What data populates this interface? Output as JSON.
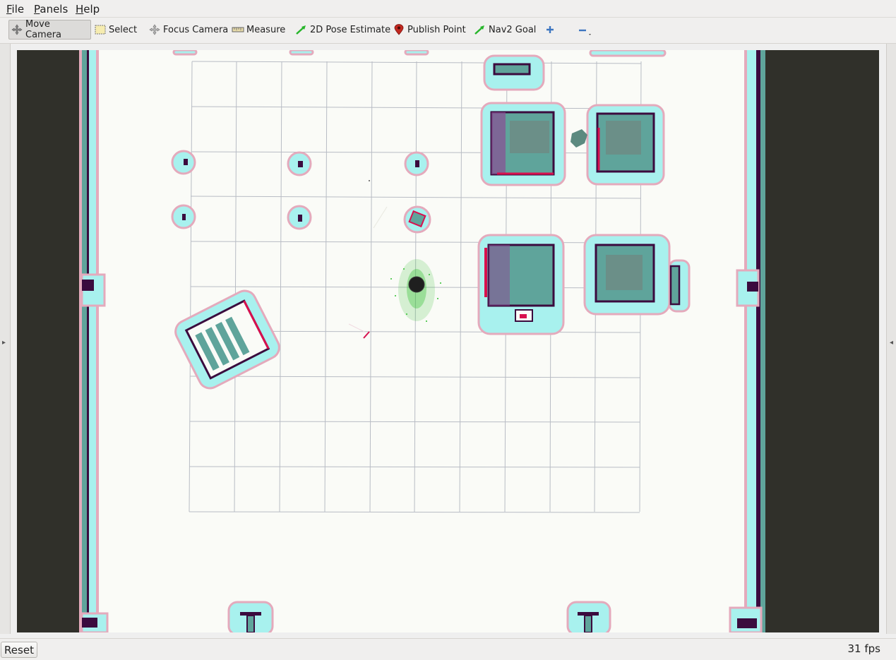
{
  "menu": {
    "items": [
      {
        "mnemonic": "F",
        "rest": "ile"
      },
      {
        "mnemonic": "P",
        "rest": "anels"
      },
      {
        "mnemonic": "H",
        "rest": "elp"
      }
    ]
  },
  "toolbar": {
    "move_camera": "Move Camera",
    "select": "Select",
    "focus_camera": "Focus Camera",
    "measure": "Measure",
    "pose_estimate": "2D Pose Estimate",
    "publish_point": "Publish Point",
    "nav2_goal": "Nav2 Goal",
    "active_tool": "Move Camera"
  },
  "icons": {
    "move": "move-camera-icon",
    "select": "select-icon",
    "focus": "focus-camera-icon",
    "measure": "measure-icon",
    "pose": "pose-arrow-icon",
    "point": "map-pin-icon",
    "goal": "goal-arrow-icon",
    "add": "plus-icon",
    "remove": "minus-icon"
  },
  "colors": {
    "map_background": "#fafbf7",
    "unknown_space": "#30302a",
    "inflation_cyan": "#a8f1ee",
    "inflation_pink": "#e4aabc",
    "obstacle": "#3b0b3e",
    "lethal_red": "#d8104e",
    "cost_teal": "#5fa49b",
    "grid_line": "#b8bcc4",
    "particles": "#2fbf2f",
    "robot": "#1f1f1f"
  },
  "status": {
    "reset": "Reset",
    "fps": "31 fps"
  }
}
